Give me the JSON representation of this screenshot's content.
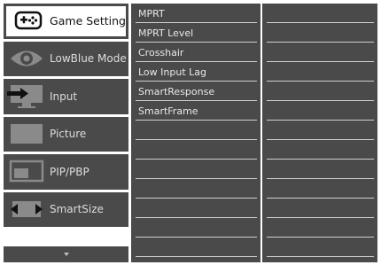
{
  "menu": {
    "items": [
      {
        "label": "Game Setting",
        "icon": "gamepad-icon",
        "selected": true
      },
      {
        "label": "LowBlue Mode",
        "icon": "eye-icon"
      },
      {
        "label": "Input",
        "icon": "input-icon"
      },
      {
        "label": "Picture",
        "icon": "picture-icon"
      },
      {
        "label": "PIP/PBP",
        "icon": "pip-icon"
      },
      {
        "label": "SmartSize",
        "icon": "smartsize-icon"
      }
    ],
    "scroll_icon": "scroll-down-icon"
  },
  "submenu": {
    "items": [
      {
        "label": "MPRT"
      },
      {
        "label": "MPRT Level"
      },
      {
        "label": "Crosshair"
      },
      {
        "label": "Low Input Lag"
      },
      {
        "label": "SmartResponse"
      },
      {
        "label": "SmartFrame"
      },
      {
        "label": ""
      },
      {
        "label": ""
      },
      {
        "label": ""
      },
      {
        "label": ""
      },
      {
        "label": ""
      },
      {
        "label": ""
      },
      {
        "label": ""
      }
    ]
  },
  "colors": {
    "panel": "#4a4a4a",
    "text": "#e8e8e8",
    "divider": "#cfcfcf"
  }
}
